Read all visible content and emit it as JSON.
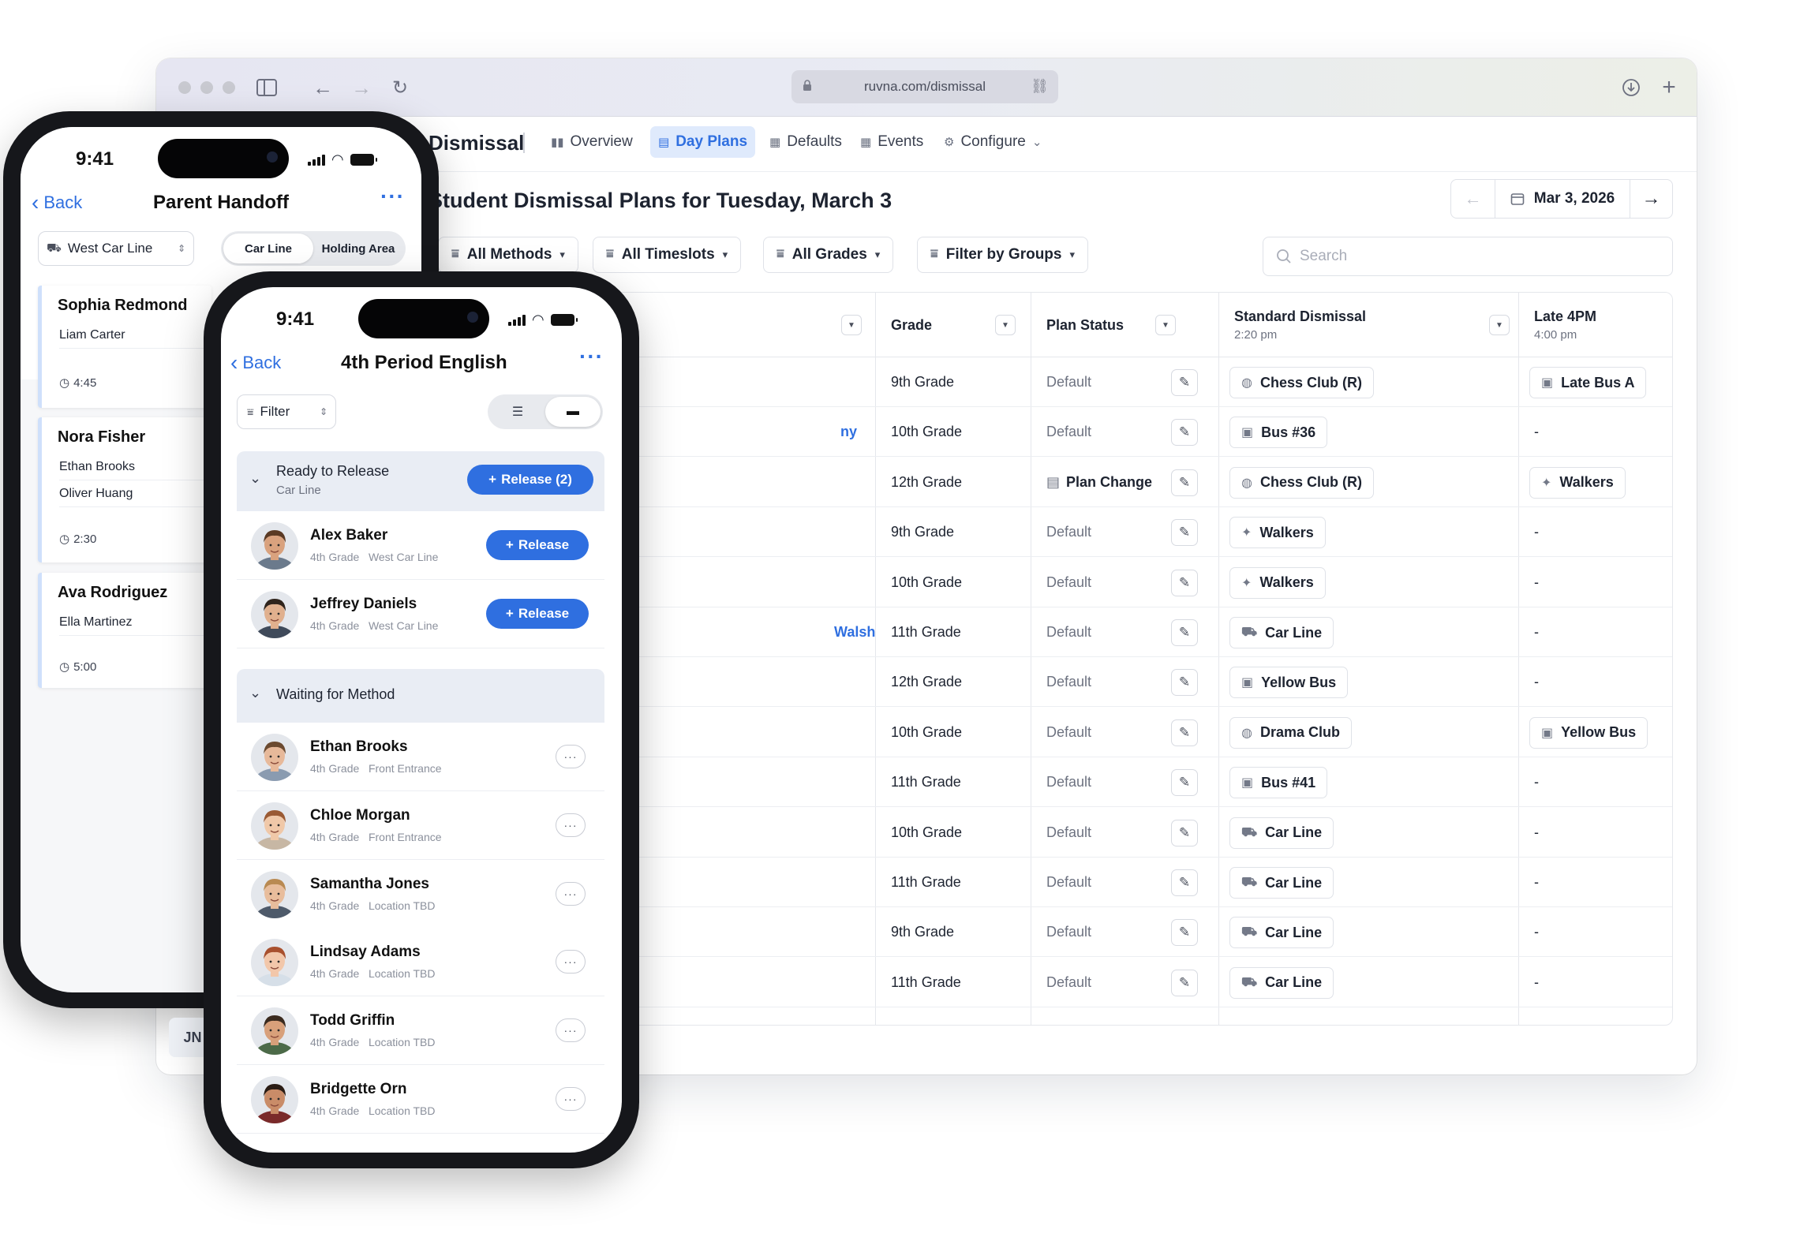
{
  "browser": {
    "url": "ruvna.com/dismissal"
  },
  "app": {
    "title": "Dismissal",
    "tabs": [
      {
        "label": "Overview",
        "icon": "chart-icon"
      },
      {
        "label": "Day Plans",
        "icon": "calendar-icon",
        "active": true
      },
      {
        "label": "Defaults",
        "icon": "grid-icon"
      },
      {
        "label": "Events",
        "icon": "events-icon"
      },
      {
        "label": "Configure",
        "icon": "gear-icon"
      }
    ],
    "page_title": "Student Dismissal Plans for Tuesday, March 3",
    "date": "Mar 3, 2026",
    "filters": [
      "All Methods",
      "All Timeslots",
      "All Grades",
      "Filter by Groups"
    ],
    "search_placeholder": "Search",
    "columns": {
      "grade": "Grade",
      "plan_status": "Plan Status",
      "standard": "Standard Dismissal",
      "standard_time": "2:20 pm",
      "late": "Late 4PM",
      "late_time": "4:00 pm"
    },
    "rows": [
      {
        "name": "",
        "grade": "9th Grade",
        "status": "Default",
        "standard": "Chess Club (R)",
        "standard_icon": "club",
        "late": "Late Bus A",
        "late_icon": "bus"
      },
      {
        "name": "ny",
        "grade": "10th Grade",
        "status": "Default",
        "standard": "Bus #36",
        "standard_icon": "bus",
        "late": "-",
        "late_icon": ""
      },
      {
        "name": "",
        "grade": "12th Grade",
        "status": "Plan Change",
        "standard": "Chess Club (R)",
        "standard_icon": "club",
        "late": "Walkers",
        "late_icon": "walk"
      },
      {
        "name": "",
        "grade": "9th Grade",
        "status": "Default",
        "standard": "Walkers",
        "standard_icon": "walk",
        "late": "-",
        "late_icon": ""
      },
      {
        "name": "",
        "grade": "10th Grade",
        "status": "Default",
        "standard": "Walkers",
        "standard_icon": "walk",
        "late": "-",
        "late_icon": ""
      },
      {
        "name": "Walsh",
        "grade": "11th Grade",
        "status": "Default",
        "standard": "Car Line",
        "standard_icon": "car",
        "late": "-",
        "late_icon": ""
      },
      {
        "name": "",
        "grade": "12th Grade",
        "status": "Default",
        "standard": "Yellow Bus",
        "standard_icon": "bus",
        "late": "-",
        "late_icon": ""
      },
      {
        "name": "",
        "grade": "10th Grade",
        "status": "Default",
        "standard": "Drama Club",
        "standard_icon": "club",
        "late": "Yellow Bus",
        "late_icon": "bus"
      },
      {
        "name": "",
        "grade": "11th Grade",
        "status": "Default",
        "standard": "Bus #41",
        "standard_icon": "bus",
        "late": "-",
        "late_icon": ""
      },
      {
        "name": "",
        "grade": "10th Grade",
        "status": "Default",
        "standard": "Car Line",
        "standard_icon": "car",
        "late": "-",
        "late_icon": ""
      },
      {
        "name": "",
        "grade": "11th Grade",
        "status": "Default",
        "standard": "Car Line",
        "standard_icon": "car",
        "late": "-",
        "late_icon": ""
      },
      {
        "name": "",
        "grade": "9th Grade",
        "status": "Default",
        "standard": "Car Line",
        "standard_icon": "car",
        "late": "-",
        "late_icon": ""
      },
      {
        "name": "",
        "grade": "11th Grade",
        "status": "Default",
        "standard": "Car Line",
        "standard_icon": "car",
        "late": "-",
        "late_icon": ""
      }
    ],
    "user_initials": "JN"
  },
  "phone1": {
    "time": "9:41",
    "back": "Back",
    "title": "Parent Handoff",
    "location": "West Car Line",
    "segments": [
      "Car Line",
      "Holding Area"
    ],
    "cards": [
      {
        "parent": "Sophia Redmond",
        "kids": [
          "Liam Carter"
        ],
        "time": "4:45"
      },
      {
        "parent": "Nora Fisher",
        "kids": [
          "Ethan Brooks",
          "Oliver Huang"
        ],
        "time": "2:30"
      },
      {
        "parent": "Ava Rodriguez",
        "kids": [
          "Ella Martinez"
        ],
        "time": "5:00"
      }
    ]
  },
  "phone2": {
    "time": "9:41",
    "back": "Back",
    "title": "4th Period English",
    "filter": "Filter",
    "ready": {
      "title": "Ready to Release",
      "subtitle": "Car Line",
      "button": "Release (2)",
      "release_label": "Release",
      "students": [
        {
          "name": "Alex Baker",
          "grade": "4th Grade",
          "location": "West Car Line",
          "skin": "#d9a27e",
          "hair": "#5a3a24",
          "shirt": "#6b7a8c"
        },
        {
          "name": "Jeffrey Daniels",
          "grade": "4th Grade",
          "location": "West Car Line",
          "skin": "#e0b08e",
          "hair": "#2f241c",
          "shirt": "#3f4a5a"
        }
      ]
    },
    "waiting": {
      "title": "Waiting for Method",
      "more_label": "···",
      "students": [
        {
          "name": "Ethan Brooks",
          "grade": "4th Grade",
          "location": "Front Entrance",
          "skin": "#e7b99a",
          "hair": "#6b4a30",
          "shirt": "#8a9bb0"
        },
        {
          "name": "Chloe Morgan",
          "grade": "4th Grade",
          "location": "Front Entrance",
          "skin": "#f0c8a8",
          "hair": "#9a5a34",
          "shirt": "#c7b7a4"
        },
        {
          "name": "Samantha Jones",
          "grade": "4th Grade",
          "location": "Location TBD",
          "skin": "#e8bd9c",
          "hair": "#b98a52",
          "shirt": "#4e5a6a"
        },
        {
          "name": "Lindsay Adams",
          "grade": "4th Grade",
          "location": "Location TBD",
          "skin": "#f2c7aa",
          "hair": "#a8502e",
          "shirt": "#d6dfe8"
        },
        {
          "name": "Todd Griffin",
          "grade": "4th Grade",
          "location": "Location TBD",
          "skin": "#d8a07a",
          "hair": "#3a2a1e",
          "shirt": "#4c6a48"
        },
        {
          "name": "Bridgette Orn",
          "grade": "4th Grade",
          "location": "Location TBD",
          "skin": "#c98c68",
          "hair": "#2a1c14",
          "shirt": "#7a2a2a"
        }
      ]
    }
  },
  "colors": {
    "accent": "#2f6fe0",
    "accent_bg": "#dfeafc",
    "section_bg": "#e9edf4"
  }
}
